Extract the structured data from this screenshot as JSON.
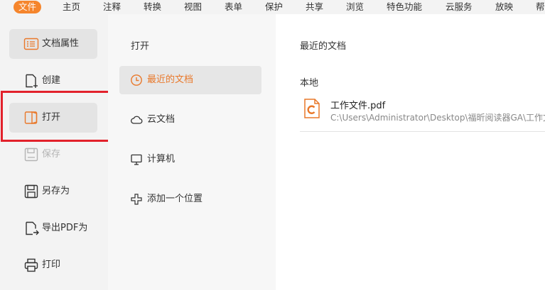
{
  "menubar": {
    "items": [
      {
        "label": "文件",
        "active": true
      },
      {
        "label": "主页"
      },
      {
        "label": "注释"
      },
      {
        "label": "转换"
      },
      {
        "label": "视图"
      },
      {
        "label": "表单"
      },
      {
        "label": "保护"
      },
      {
        "label": "共享"
      },
      {
        "label": "浏览"
      },
      {
        "label": "特色功能"
      },
      {
        "label": "云服务"
      },
      {
        "label": "放映"
      },
      {
        "label": "帮"
      }
    ]
  },
  "leftnav": {
    "items": [
      {
        "label": "文档属性",
        "icon": "document-properties-icon"
      },
      {
        "label": "创建",
        "icon": "create-document-icon"
      },
      {
        "label": "打开",
        "icon": "open-folder-icon"
      },
      {
        "label": "保存",
        "icon": "save-icon",
        "disabled": true
      },
      {
        "label": "另存为",
        "icon": "save-as-icon"
      },
      {
        "label": "导出PDF为",
        "icon": "export-pdf-icon"
      },
      {
        "label": "打印",
        "icon": "printer-icon"
      }
    ]
  },
  "midpanel": {
    "title": "打开",
    "items": [
      {
        "label": "最近的文档",
        "icon": "clock-icon"
      },
      {
        "label": "云文档",
        "icon": "cloud-icon"
      },
      {
        "label": "计算机",
        "icon": "monitor-icon"
      },
      {
        "label": "添加一个位置",
        "icon": "plus-icon"
      }
    ]
  },
  "content": {
    "title": "最近的文档",
    "section": "本地",
    "files": [
      {
        "name": "工作文件.pdf",
        "path": "C:\\Users\\Administrator\\Desktop\\福昕阅读器GA\\工作文件"
      }
    ]
  },
  "colors": {
    "accent": "#f5852c",
    "highlight_border": "#e2212b",
    "sidebar_bg": "#f3f3f3"
  }
}
